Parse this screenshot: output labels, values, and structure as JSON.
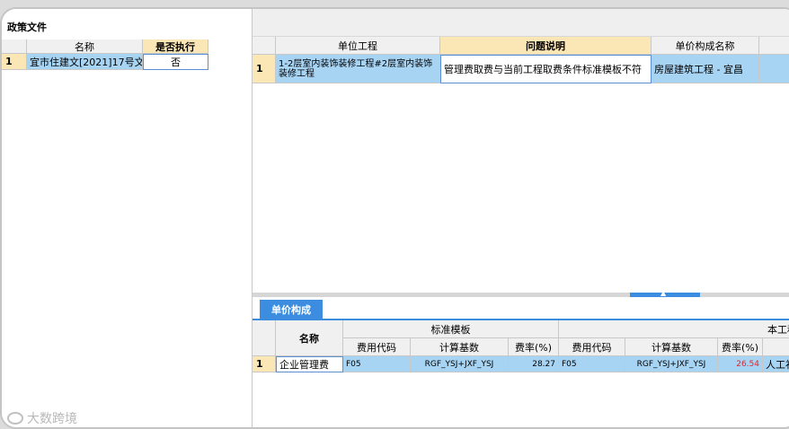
{
  "left": {
    "title": "政策文件",
    "columns": [
      "名称",
      "是否执行"
    ],
    "rows": [
      {
        "num": "1",
        "name": "宜市住建文[2021]17号文",
        "execute": "否"
      }
    ]
  },
  "right": {
    "columns": [
      "单位工程",
      "问题说明",
      "单价构成名称"
    ],
    "rows": [
      {
        "num": "1",
        "project": "1-2层室内装饰装修工程#2层室内装饰装修工程",
        "issue": "管理费取费与当前工程取费条件标准模板不符",
        "composition": "房屋建筑工程 - 宜昌"
      }
    ]
  },
  "bottom": {
    "tab": "单价构成",
    "name_header": "名称",
    "group_standard": "标准模板",
    "group_this": "本工程模",
    "sub_headers": [
      "费用代码",
      "计算基数",
      "费率(%)",
      "费用代码",
      "计算基数",
      "费率(%)"
    ],
    "rows": [
      {
        "num": "1",
        "name": "企业管理费",
        "std_code": "F05",
        "std_base": "RGF_YSJ+JXF_YSJ",
        "std_rate": "28.27",
        "this_code": "F05",
        "this_base": "RGF_YSJ+JXF_YSJ",
        "this_rate": "26.54",
        "extra": "人工补"
      }
    ]
  },
  "watermark": "大数跨境",
  "colors": {
    "accent": "#3c8de0",
    "header_yellow": "#fbe6b6",
    "selected_row": "#a8d4f4",
    "rate_red": "#e0262e"
  }
}
